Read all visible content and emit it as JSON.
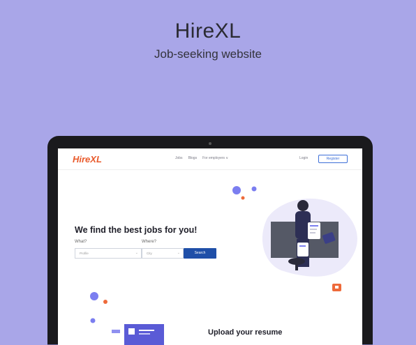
{
  "header": {
    "title": "HireXL",
    "subtitle": "Job-seeking website"
  },
  "site": {
    "logo": "HireXL",
    "nav": {
      "jobs": "Jobs",
      "blogs": "Blogs",
      "employers": "For employers ∨"
    },
    "login": "Login",
    "register": "Register"
  },
  "hero": {
    "heading": "We find the best jobs for you!",
    "what_label": "What?",
    "where_label": "Where?",
    "what_value": "Profile",
    "where_value": "City",
    "search": "Search"
  },
  "section2": {
    "heading": "Upload your resume"
  },
  "colors": {
    "background": "#a9a6e8",
    "brand": "#e95a2b",
    "button": "#1f4fa8",
    "accent": "#6b6ee6"
  }
}
